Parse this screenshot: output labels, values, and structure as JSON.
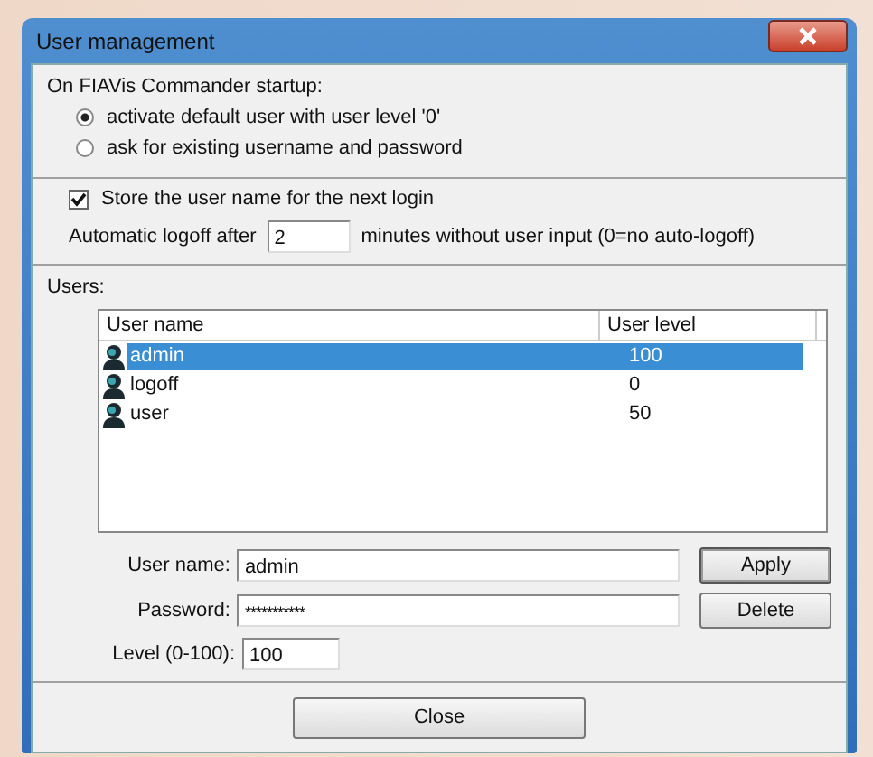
{
  "window": {
    "title": "User management"
  },
  "startup": {
    "heading": "On FIAVis Commander startup:",
    "options": [
      {
        "label": "activate default user with user level '0'",
        "selected": true
      },
      {
        "label": "ask for existing username and password",
        "selected": false
      }
    ]
  },
  "store_username": {
    "label": "Store the user name for the next login",
    "checked": true
  },
  "logoff": {
    "label": "Automatic logoff after",
    "value": "2",
    "suffix": "minutes without user input (0=no auto-logoff)"
  },
  "users": {
    "heading": "Users:",
    "columns": [
      "User name",
      "User level"
    ],
    "rows": [
      {
        "name": "admin",
        "level": "100",
        "selected": true
      },
      {
        "name": "logoff",
        "level": "0",
        "selected": false
      },
      {
        "name": "user",
        "level": "50",
        "selected": false
      }
    ]
  },
  "form": {
    "username_label": "User name:",
    "username": "admin",
    "password_label": "Password:",
    "password": "***********",
    "level_label": "Level (0-100):",
    "level": "100"
  },
  "buttons": {
    "apply": "Apply",
    "delete": "Delete",
    "close": "Close"
  }
}
